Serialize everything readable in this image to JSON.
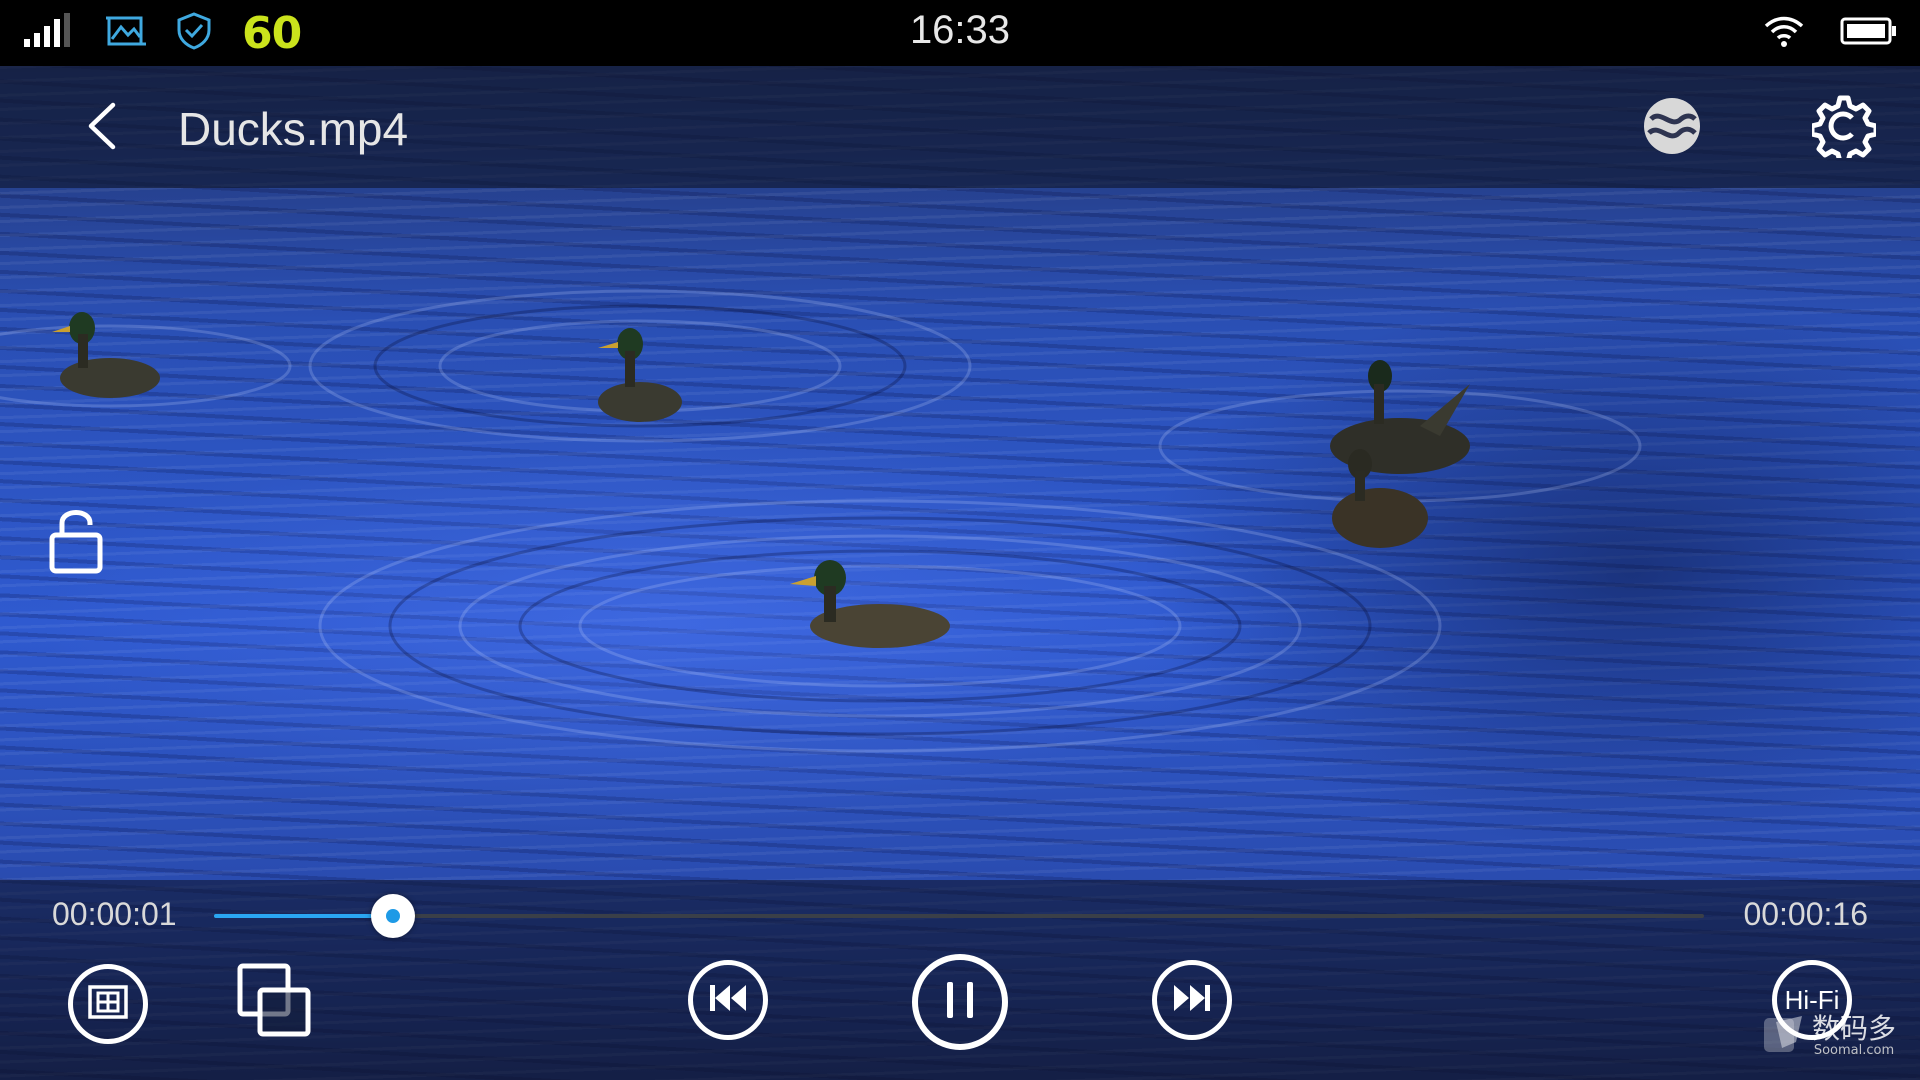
{
  "status_bar": {
    "fps": "60",
    "time": "16:33",
    "icons": [
      "signal-icon",
      "screenshot-icon",
      "shield-icon",
      "wifi-icon",
      "battery-icon"
    ]
  },
  "header": {
    "title": "Ducks.mp4",
    "icons": [
      "back-icon",
      "mix-icon",
      "settings-icon"
    ]
  },
  "player": {
    "current_time": "00:00:01",
    "total_time": "00:00:16",
    "progress": 0.12,
    "hifi_label": "Hi-Fi",
    "accent_color": "#2aa6f2"
  },
  "watermark": {
    "text": "数码多",
    "sub": "Soomal.com"
  }
}
